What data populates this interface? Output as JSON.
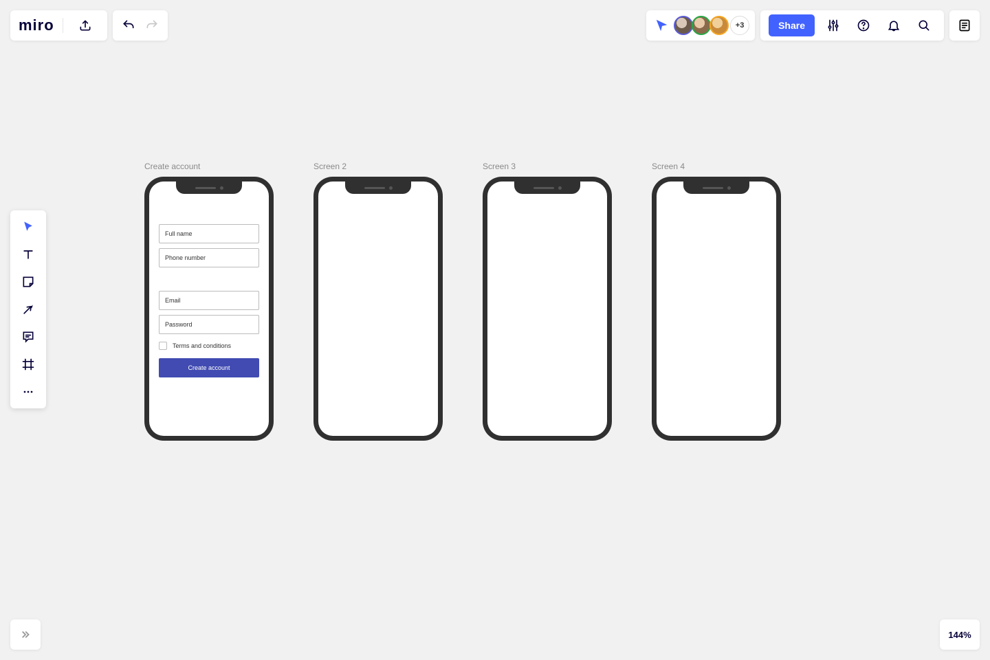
{
  "logo": "miro",
  "collab": {
    "more_count": "+3",
    "share_label": "Share"
  },
  "zoom": "144%",
  "frames": [
    {
      "label": "Create account",
      "form": {
        "fields_top": [
          "Full name",
          "Phone number"
        ],
        "fields_bottom": [
          "Email",
          "Password"
        ],
        "checkbox_label": "Terms and conditions",
        "button_label": "Create account"
      }
    },
    {
      "label": "Screen 2"
    },
    {
      "label": "Screen 3"
    },
    {
      "label": "Screen 4"
    }
  ]
}
